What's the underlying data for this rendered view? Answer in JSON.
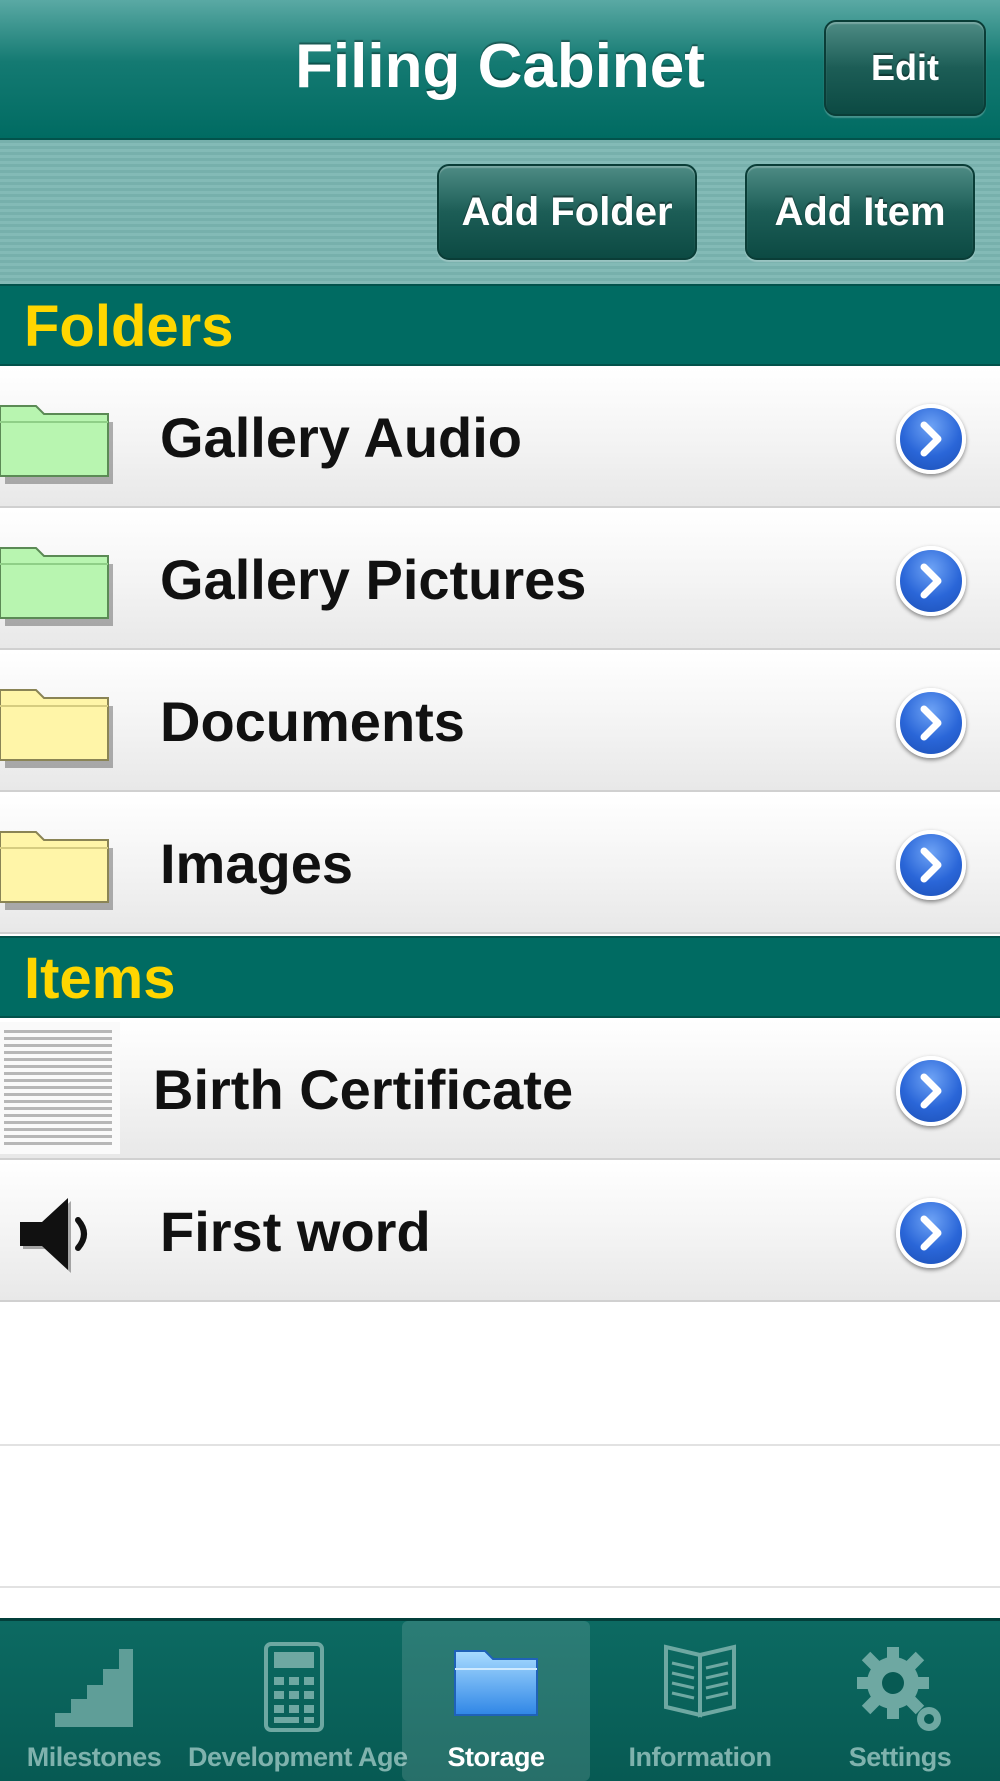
{
  "navbar": {
    "title": "Filing Cabinet",
    "edit_label": "Edit"
  },
  "toolbar": {
    "add_folder_label": "Add Folder",
    "add_item_label": "Add Item"
  },
  "sections": {
    "folders": {
      "header": "Folders",
      "rows": [
        {
          "label": "Gallery Audio",
          "icon": "green-folder-icon"
        },
        {
          "label": "Gallery Pictures",
          "icon": "green-folder-icon"
        },
        {
          "label": "Documents",
          "icon": "yellow-folder-icon"
        },
        {
          "label": "Images",
          "icon": "yellow-folder-icon"
        }
      ]
    },
    "items": {
      "header": "Items",
      "rows": [
        {
          "label": "Birth Certificate",
          "icon": "document-thumbnail"
        },
        {
          "label": "First word",
          "icon": "speaker-icon"
        }
      ]
    }
  },
  "tabbar": {
    "tabs": [
      {
        "label": "Milestones",
        "icon": "bar-chart-icon",
        "selected": false
      },
      {
        "label": "Development Age",
        "icon": "calculator-icon",
        "selected": false
      },
      {
        "label": "Storage",
        "icon": "folder-icon",
        "selected": true
      },
      {
        "label": "Information",
        "icon": "book-icon",
        "selected": false
      },
      {
        "label": "Settings",
        "icon": "gear-icon",
        "selected": false
      }
    ]
  },
  "colors": {
    "navbar": "#006b62",
    "section_header_text": "#ffd600",
    "disclosure": "#2a66d8",
    "green_folder": "#b8f5b0",
    "yellow_folder": "#fff5a8"
  }
}
